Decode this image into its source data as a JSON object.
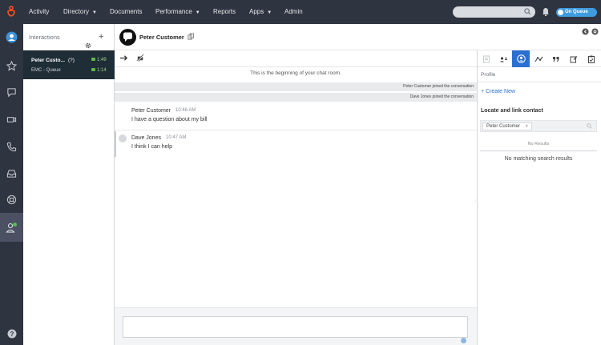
{
  "topnav": {
    "items": [
      {
        "label": "Activity",
        "has_dropdown": false
      },
      {
        "label": "Directory",
        "has_dropdown": true
      },
      {
        "label": "Documents",
        "has_dropdown": false
      },
      {
        "label": "Performance",
        "has_dropdown": true
      },
      {
        "label": "Reports",
        "has_dropdown": false
      },
      {
        "label": "Apps",
        "has_dropdown": true
      },
      {
        "label": "Admin",
        "has_dropdown": false
      }
    ],
    "search_placeholder": "",
    "status_toggle": "On Queue",
    "colors": {
      "bar": "#2e3440",
      "logo": "#ff4f1f",
      "status": "#3f9be0"
    }
  },
  "rail": {
    "icons": [
      "user-avatar-icon",
      "star-icon",
      "chat-bubble-icon",
      "video-icon",
      "phone-icon",
      "inbox-icon",
      "lifebuoy-icon",
      "agent-status-icon",
      "help-icon"
    ]
  },
  "interactions": {
    "title": "Interactions",
    "items": [
      {
        "name": "Peter Custo...",
        "badge": "(?)",
        "queue": "EMC - Queue",
        "time1": "1:49",
        "time2": "1:14"
      }
    ]
  },
  "conversation": {
    "title": "Peter Customer",
    "begin_text": "This is the beginning of your chat room.",
    "system_messages": [
      "Peter Customer joined the conversation",
      "Dave Jones joined the conversation"
    ],
    "messages": [
      {
        "sender": "Peter Customer",
        "time": "10:46 AM",
        "text": "I have a question about my bill"
      },
      {
        "sender": "Dave Jones",
        "time": "10:47 AM",
        "text": "I think I can help"
      }
    ],
    "composer_placeholder": ""
  },
  "right_panel": {
    "section": "Profile",
    "create_new": "+ Create New",
    "locate_title": "Locate and link contact",
    "search_chip": "Peter Customer",
    "chip_close": "x",
    "no_results": "No Results",
    "no_match": "No matching search results",
    "accent": "#2a6fd1"
  }
}
